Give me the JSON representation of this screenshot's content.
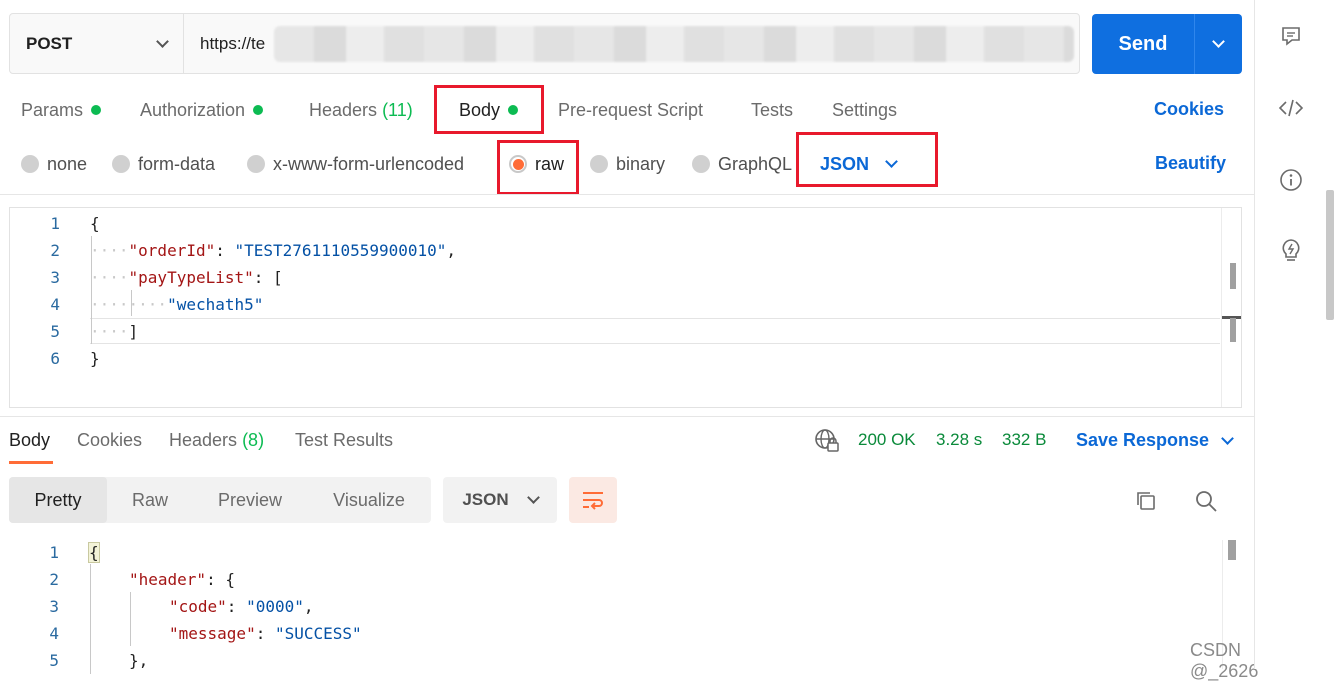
{
  "request": {
    "method": "POST",
    "url_visible": "https://te",
    "send_label": "Send"
  },
  "request_tabs": [
    {
      "label": "Params",
      "count": "",
      "dot": true
    },
    {
      "label": "Authorization",
      "count": "",
      "dot": true
    },
    {
      "label": "Headers",
      "count": "(11)",
      "dot": false
    },
    {
      "label": "Body",
      "count": "",
      "dot": true
    },
    {
      "label": "Pre-request Script",
      "count": "",
      "dot": false
    },
    {
      "label": "Tests",
      "count": "",
      "dot": false
    },
    {
      "label": "Settings",
      "count": "",
      "dot": false
    }
  ],
  "cookies_label": "Cookies",
  "beautify_label": "Beautify",
  "body_types": [
    "none",
    "form-data",
    "x-www-form-urlencoded",
    "raw",
    "binary",
    "GraphQL"
  ],
  "selected_body_type": "raw",
  "body_format": "JSON",
  "request_body": {
    "line_numbers": [
      "1",
      "2",
      "3",
      "4",
      "5",
      "6"
    ],
    "open_brace": "{",
    "key_orderId": "\"orderId\"",
    "val_orderId": "\"TEST2761110559900010\"",
    "key_payTypeList": "\"payTypeList\"",
    "open_bracket": "[",
    "val_pay": "\"wechath5\"",
    "close_bracket": "]",
    "close_brace": "}"
  },
  "response_tabs": [
    {
      "label": "Body",
      "count": ""
    },
    {
      "label": "Cookies",
      "count": ""
    },
    {
      "label": "Headers",
      "count": "(8)"
    },
    {
      "label": "Test Results",
      "count": ""
    }
  ],
  "response_status": {
    "code": "200 OK",
    "time": "3.28 s",
    "size": "332 B"
  },
  "save_response_label": "Save Response",
  "view_modes": [
    "Pretty",
    "Raw",
    "Preview",
    "Visualize"
  ],
  "response_format": "JSON",
  "response_body": {
    "line_numbers": [
      "1",
      "2",
      "3",
      "4",
      "5"
    ],
    "open_brace": "{",
    "key_header": "\"header\"",
    "key_code": "\"code\"",
    "val_code": "\"0000\"",
    "key_message": "\"message\"",
    "val_message": "\"SUCCESS\"",
    "close_obj": "},"
  },
  "watermark": "CSDN @_2626",
  "colors": {
    "accent": "#0f6fe0",
    "highlight_box": "#e8192c",
    "status_green": "#0a8a3a",
    "brand_orange": "#ff6c37"
  },
  "sidebar_icons": [
    "comment-icon",
    "code-icon",
    "info-icon",
    "lightbulb-icon"
  ]
}
